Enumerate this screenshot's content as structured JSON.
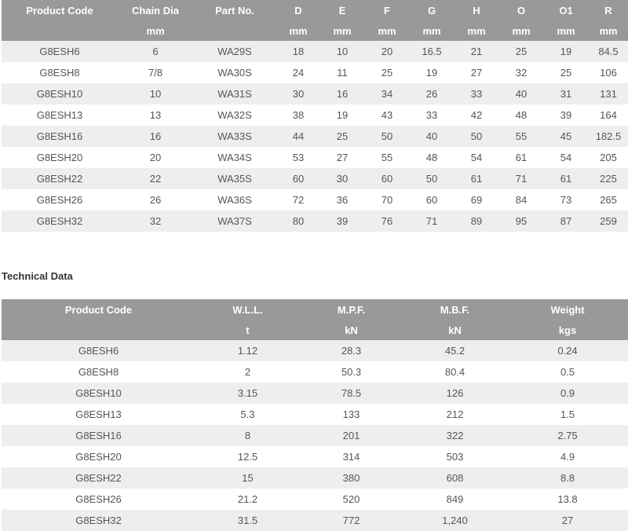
{
  "dimensions_table": {
    "headers": [
      "Product Code",
      "Chain Dia",
      "Part No.",
      "D",
      "E",
      "F",
      "G",
      "H",
      "O",
      "O1",
      "R"
    ],
    "units": [
      "",
      "mm",
      "",
      "mm",
      "mm",
      "mm",
      "mm",
      "mm",
      "mm",
      "mm",
      "mm"
    ],
    "rows": [
      [
        "G8ESH6",
        "6",
        "WA29S",
        "18",
        "10",
        "20",
        "16.5",
        "21",
        "25",
        "19",
        "84.5"
      ],
      [
        "G8ESH8",
        "7/8",
        "WA30S",
        "24",
        "11",
        "25",
        "19",
        "27",
        "32",
        "25",
        "106"
      ],
      [
        "G8ESH10",
        "10",
        "WA31S",
        "30",
        "16",
        "34",
        "26",
        "33",
        "40",
        "31",
        "131"
      ],
      [
        "G8ESH13",
        "13",
        "WA32S",
        "38",
        "19",
        "43",
        "33",
        "42",
        "48",
        "39",
        "164"
      ],
      [
        "G8ESH16",
        "16",
        "WA33S",
        "44",
        "25",
        "50",
        "40",
        "50",
        "55",
        "45",
        "182.5"
      ],
      [
        "G8ESH20",
        "20",
        "WA34S",
        "53",
        "27",
        "55",
        "48",
        "54",
        "61",
        "54",
        "205"
      ],
      [
        "G8ESH22",
        "22",
        "WA35S",
        "60",
        "30",
        "60",
        "50",
        "61",
        "71",
        "61",
        "225"
      ],
      [
        "G8ESH26",
        "26",
        "WA36S",
        "72",
        "36",
        "70",
        "60",
        "69",
        "84",
        "73",
        "265"
      ],
      [
        "G8ESH32",
        "32",
        "WA37S",
        "80",
        "39",
        "76",
        "71",
        "89",
        "95",
        "87",
        "259"
      ]
    ]
  },
  "technical_heading": "Technical Data",
  "technical_table": {
    "headers": [
      "Product Code",
      "W.L.L.",
      "M.P.F.",
      "M.B.F.",
      "Weight"
    ],
    "units": [
      "",
      "t",
      "kN",
      "kN",
      "kgs"
    ],
    "rows": [
      [
        "G8ESH6",
        "1.12",
        "28.3",
        "45.2",
        "0.24"
      ],
      [
        "G8ESH8",
        "2",
        "50.3",
        "80.4",
        "0.5"
      ],
      [
        "G8ESH10",
        "3.15",
        "78.5",
        "126",
        "0.9"
      ],
      [
        "G8ESH13",
        "5.3",
        "133",
        "212",
        "1.5"
      ],
      [
        "G8ESH16",
        "8",
        "201",
        "322",
        "2.75"
      ],
      [
        "G8ESH20",
        "12.5",
        "314",
        "503",
        "4.9"
      ],
      [
        "G8ESH22",
        "15",
        "380",
        "608",
        "8.8"
      ],
      [
        "G8ESH26",
        "21.2",
        "520",
        "849",
        "13.8"
      ],
      [
        "G8ESH32",
        "31.5",
        "772",
        "1,240",
        "27"
      ]
    ]
  },
  "colors": {
    "header_bg": "#999999",
    "header_text": "#ffffff",
    "stripe_bg": "#eeeeee",
    "cell_text": "#555555"
  }
}
